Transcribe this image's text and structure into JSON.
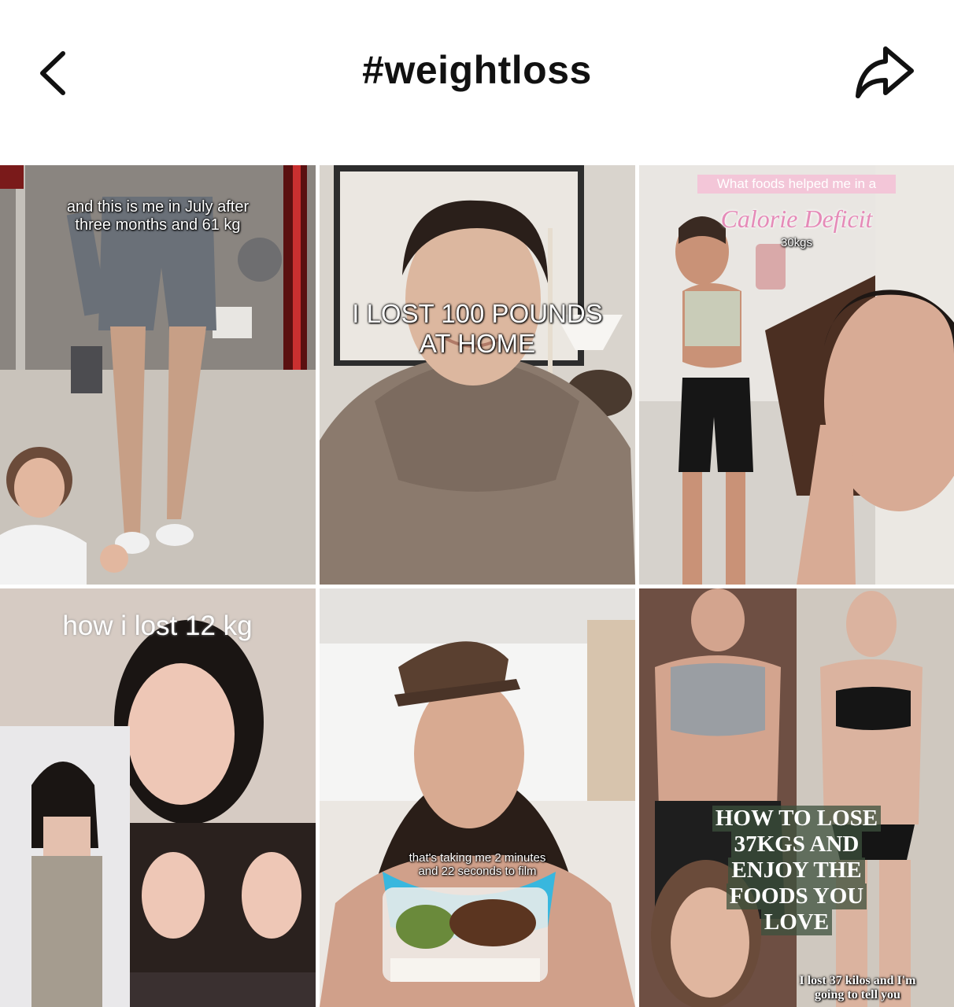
{
  "header": {
    "title": "#weightloss",
    "back_icon": "chevron-left-icon",
    "share_icon": "share-arrow-icon"
  },
  "videos": [
    {
      "caption_lines": [
        "and this is me in July after",
        "three months and 61 kg"
      ]
    },
    {
      "caption_lines": [
        "I LOST 100 POUNDS",
        "AT HOME"
      ]
    },
    {
      "banner": "What foods helped me in a",
      "headline": "Calorie Deficit",
      "sub": "30kgs"
    },
    {
      "caption": "how i lost 12 kg"
    },
    {
      "caption_lines": [
        "that's taking me 2 minutes",
        "and 22 seconds to film"
      ]
    },
    {
      "headline_lines": [
        "HOW TO LOSE",
        "37KGS AND",
        "ENJOY THE",
        "FOODS YOU",
        "LOVE"
      ],
      "sub_lines": [
        "I lost 37 kilos and I'm",
        "going to tell you"
      ]
    }
  ]
}
